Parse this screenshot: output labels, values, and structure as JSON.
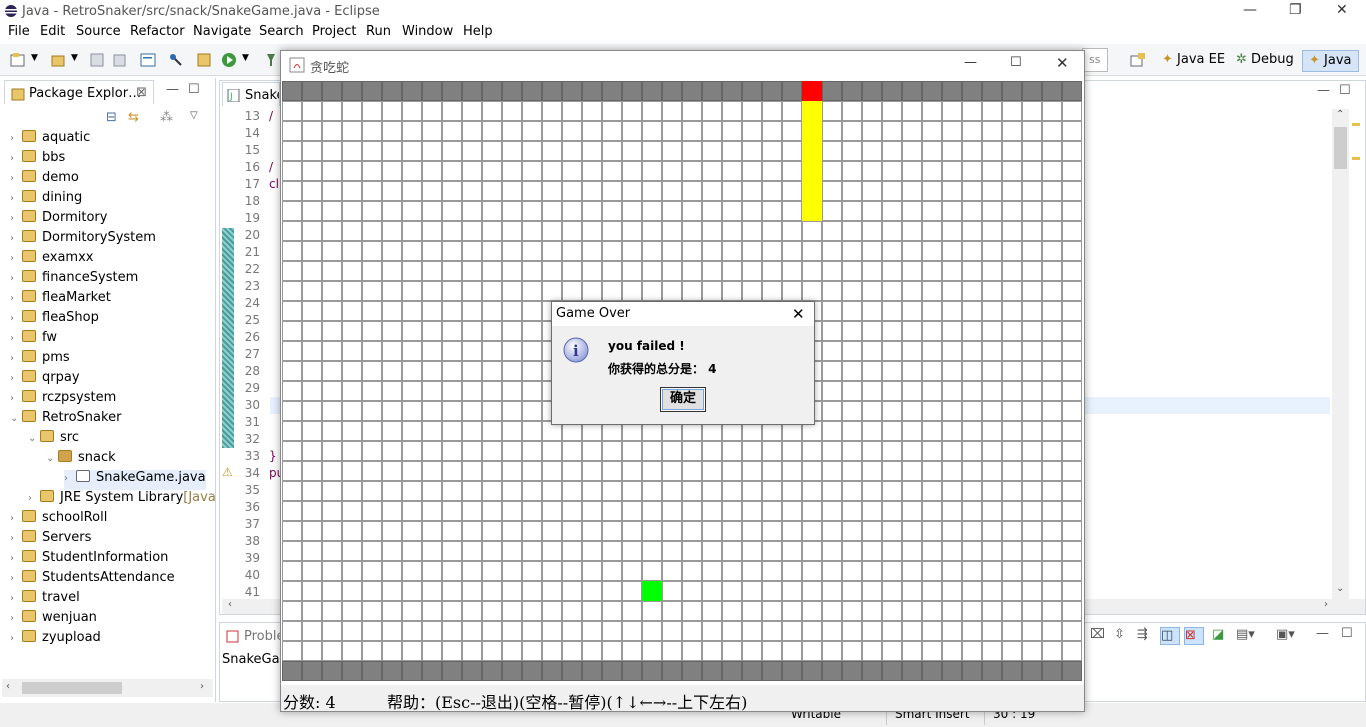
{
  "window": {
    "title": "Java - RetroSnaker/src/snack/SnakeGame.java - Eclipse"
  },
  "menu": [
    "File",
    "Edit",
    "Source",
    "Refactor",
    "Navigate",
    "Search",
    "Project",
    "Run",
    "Window",
    "Help"
  ],
  "toolbar": {
    "quick_access_fragment": "ss",
    "perspectives": [
      "Java EE",
      "Debug",
      "Java"
    ]
  },
  "package_explorer": {
    "tab": "Package Explor…",
    "items": [
      {
        "label": "aquatic",
        "level": 0,
        "expanded": false
      },
      {
        "label": "bbs",
        "level": 0,
        "expanded": false
      },
      {
        "label": "demo",
        "level": 0,
        "expanded": false
      },
      {
        "label": "dining",
        "level": 0,
        "expanded": false
      },
      {
        "label": "Dormitory",
        "level": 0,
        "expanded": false
      },
      {
        "label": "DormitorySystem",
        "level": 0,
        "expanded": false
      },
      {
        "label": "examxx",
        "level": 0,
        "expanded": false
      },
      {
        "label": "financeSystem",
        "level": 0,
        "expanded": false
      },
      {
        "label": "fleaMarket",
        "level": 0,
        "expanded": false
      },
      {
        "label": "fleaShop",
        "level": 0,
        "expanded": false
      },
      {
        "label": "fw",
        "level": 0,
        "expanded": false
      },
      {
        "label": "pms",
        "level": 0,
        "expanded": false
      },
      {
        "label": "qrpay",
        "level": 0,
        "expanded": false
      },
      {
        "label": "rczpsystem",
        "level": 0,
        "expanded": false
      },
      {
        "label": "RetroSnaker",
        "level": 0,
        "expanded": true
      },
      {
        "label": "src",
        "level": 1,
        "expanded": true
      },
      {
        "label": "snack",
        "level": 2,
        "expanded": true
      },
      {
        "label": "SnakeGame.java",
        "level": 3,
        "expanded": false
      },
      {
        "label": "JRE System Library",
        "level": 1,
        "expanded": false,
        "suffix": "[Java"
      },
      {
        "label": "schoolRoll",
        "level": 0,
        "expanded": false
      },
      {
        "label": "Servers",
        "level": 0,
        "expanded": false
      },
      {
        "label": "StudentInformation",
        "level": 0,
        "expanded": false
      },
      {
        "label": "StudentsAttendance",
        "level": 0,
        "expanded": false
      },
      {
        "label": "travel",
        "level": 0,
        "expanded": false
      },
      {
        "label": "wenjuan",
        "level": 0,
        "expanded": false
      },
      {
        "label": "zyupload",
        "level": 0,
        "expanded": false
      }
    ]
  },
  "editor": {
    "tab": "SnakeG",
    "lines": [
      {
        "n": "13",
        "code": "/"
      },
      {
        "n": "14",
        "code": " "
      },
      {
        "n": "15",
        "code": " "
      },
      {
        "n": "16",
        "code": "/"
      },
      {
        "n": "17",
        "code": "cl"
      },
      {
        "n": "18",
        "code": ""
      },
      {
        "n": "19",
        "code": ""
      },
      {
        "n": "20",
        "code": ""
      },
      {
        "n": "21",
        "code": ""
      },
      {
        "n": "22",
        "code": ""
      },
      {
        "n": "23",
        "code": ""
      },
      {
        "n": "24",
        "code": ""
      },
      {
        "n": "25",
        "code": ""
      },
      {
        "n": "26",
        "code": ""
      },
      {
        "n": "27",
        "code": ""
      },
      {
        "n": "28",
        "code": ""
      },
      {
        "n": "29",
        "code": ""
      },
      {
        "n": "30",
        "code": ""
      },
      {
        "n": "31",
        "code": ""
      },
      {
        "n": "32",
        "code": ""
      },
      {
        "n": "33",
        "code": "}"
      },
      {
        "n": "34",
        "code": "pu"
      },
      {
        "n": "35",
        "code": ""
      },
      {
        "n": "36",
        "code": ""
      },
      {
        "n": "37",
        "code": ""
      },
      {
        "n": "38",
        "code": ""
      },
      {
        "n": "39",
        "code": ""
      },
      {
        "n": "40",
        "code": ""
      },
      {
        "n": "41",
        "code": ""
      }
    ]
  },
  "bottom_panel": {
    "tab": "Proble",
    "content": "SnakeGam"
  },
  "status_bar": {
    "writable": "Writable",
    "insert_mode": "Smart Insert",
    "position": "30 : 19"
  },
  "game_window": {
    "title": "贪吃蛇",
    "footer": {
      "score": "分数: 4",
      "help": "帮助：(Esc--退出)(空格--暂停)(↑↓←→--上下左右)"
    }
  },
  "game": {
    "columns": 40,
    "rows": 30,
    "border_color": "#808080",
    "snake": {
      "head": [
        26,
        0
      ],
      "body": [
        [
          26,
          1
        ],
        [
          26,
          2
        ],
        [
          26,
          3
        ],
        [
          26,
          4
        ],
        [
          26,
          5
        ],
        [
          26,
          6
        ]
      ],
      "head_color": "#ff0000",
      "body_color": "#ffff00"
    },
    "food": {
      "cell": [
        18,
        25
      ],
      "color": "#00ff00"
    }
  },
  "dialog": {
    "title": "Game Over",
    "line1": "you failed !",
    "line2": "你获得的总分是： 4",
    "ok": "确定"
  }
}
